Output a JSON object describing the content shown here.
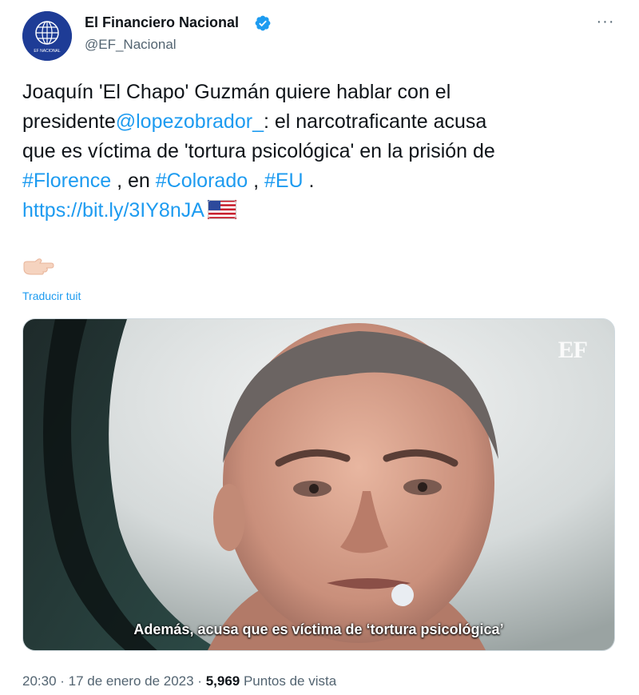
{
  "author": {
    "name": "El Financiero Nacional",
    "handle": "@EF_Nacional",
    "avatar_text": "EF NACIONAL",
    "verified": true
  },
  "more_label": "···",
  "tweet": {
    "line1": "Joaquín 'El Chapo' Guzmán quiere hablar con el",
    "line2_prefix": "presidente",
    "mention": "@lopezobrador_",
    "line2_suffix": ": el narcotraficante acusa",
    "line3": "que es víctima de 'tortura psicológica' en la prisión de",
    "hashtag1": "#Florence",
    "sep1": " , en ",
    "hashtag2": "#Colorado",
    "sep2": " , ",
    "hashtag3": "#EU",
    "end": " .",
    "url": "https://bit.ly/3IY8nJA"
  },
  "translate_label": "Traducir tuit",
  "media": {
    "watermark": "EF",
    "subtitle": "Además, acusa que es víctima de ‘tortura psicológica’"
  },
  "meta": {
    "time": "20:30",
    "dot1": " · ",
    "date": "17 de enero de 2023",
    "dot2": " · ",
    "views_count": "5,969",
    "views_label": " Puntos de vista"
  },
  "colors": {
    "link": "#1d9bf0",
    "verified": "#1d9bf0",
    "text": "#0f1419",
    "secondary": "#536471"
  }
}
